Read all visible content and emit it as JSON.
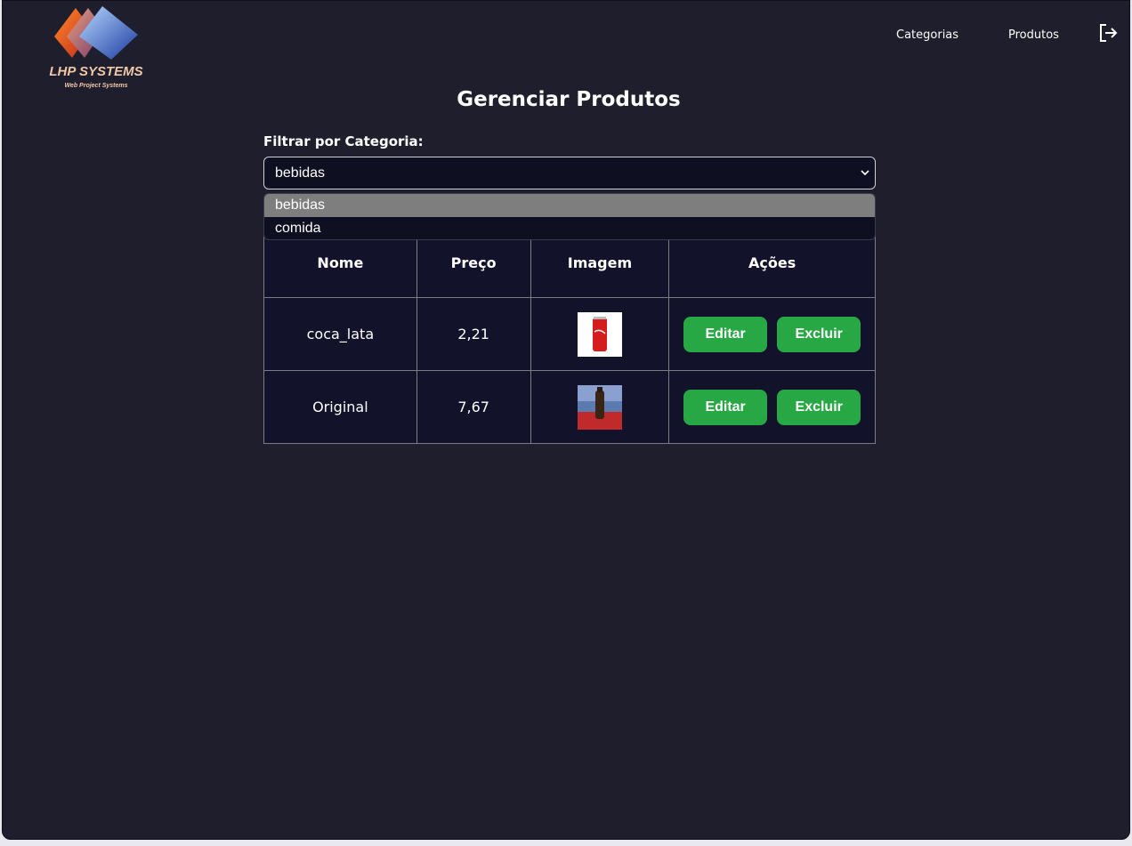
{
  "brand": {
    "name": "LHP SYSTEMS",
    "tagline": "Web Project Systems"
  },
  "nav": {
    "categories": "Categorias",
    "products": "Produtos",
    "logout_icon": "logout-icon"
  },
  "page": {
    "title": "Gerenciar Produtos"
  },
  "filter": {
    "label": "Filtrar por Categoria:",
    "selected": "bebidas",
    "options": [
      "bebidas",
      "comida"
    ]
  },
  "table": {
    "headers": [
      "Nome",
      "Preço",
      "Imagem",
      "Ações"
    ],
    "rows": [
      {
        "name": "coca_lata",
        "price": "2,21",
        "image": "coca-can-thumbnail"
      },
      {
        "name": "Original",
        "price": "7,67",
        "image": "bottle-photo-thumbnail"
      }
    ],
    "edit_label": "Editar",
    "delete_label": "Excluir"
  },
  "colors": {
    "background": "#1e1e2d",
    "button": "#28a745",
    "table_bg": "#12122a"
  }
}
